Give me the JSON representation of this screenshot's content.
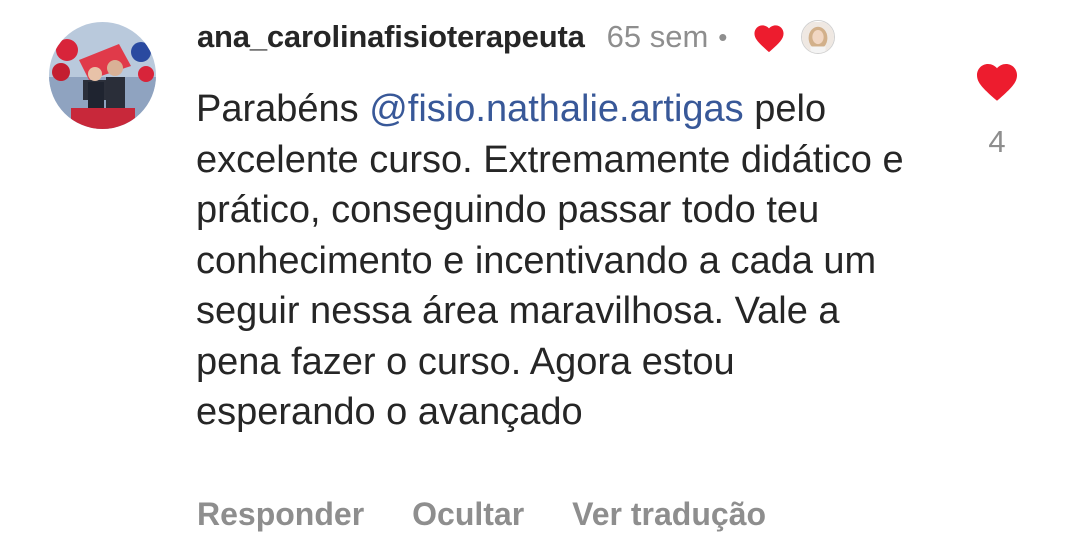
{
  "comment": {
    "username": "ana_carolinafisioterapeuta",
    "time": "65 sem",
    "separator": "•",
    "text_before_mention": "Parabéns ",
    "mention": "@fisio.nathalie.artigas",
    "text_after_mention": " pelo excelente curso. Extremamente didático e prático, conseguindo passar todo teu conhecimento e incentivando a cada um seguir nessa área maravilhosa. Vale a pena fazer o curso. Agora estou esperando o avançado",
    "like_count": "4",
    "author_liked": true
  },
  "actions": {
    "reply": "Responder",
    "hide": "Ocultar",
    "translate": "Ver tradução"
  },
  "icons": {
    "liked_by_author": "heart-icon",
    "like": "heart-icon"
  },
  "colors": {
    "heart": "#ed1c2e",
    "mention": "#385898",
    "muted": "#8e8e8e",
    "text": "#262626"
  }
}
